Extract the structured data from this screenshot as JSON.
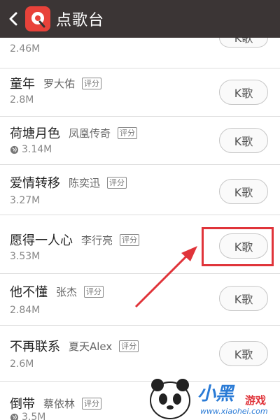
{
  "header": {
    "title": "点歌台"
  },
  "score_tag": "评分",
  "k_label": "K歌",
  "songs": [
    {
      "size": "2.46M"
    },
    {
      "name": "童年",
      "artist": "罗大佑",
      "size": "2.8M"
    },
    {
      "name": "荷塘月色",
      "artist": "凤凰传奇",
      "size": "3.14M",
      "local": true
    },
    {
      "name": "爱情转移",
      "artist": "陈奕迅",
      "size": "3.27M"
    },
    {
      "name": "愿得一人心",
      "artist": "李行亮",
      "size": "3.53M"
    },
    {
      "name": "他不懂",
      "artist": "张杰",
      "size": "2.84M"
    },
    {
      "name": "不再联系",
      "artist": "夏天Alex",
      "size": "2.6M"
    },
    {
      "name": "倒带",
      "artist": "蔡依林",
      "size": "3.5M",
      "local": true
    }
  ],
  "watermark": {
    "brand": "小黑",
    "brand2": "游戏",
    "url": "www.xiaohei.com"
  },
  "colors": {
    "header_bg": "#3b3535",
    "logo": "#e8423a",
    "annotation": "#e0343a"
  }
}
